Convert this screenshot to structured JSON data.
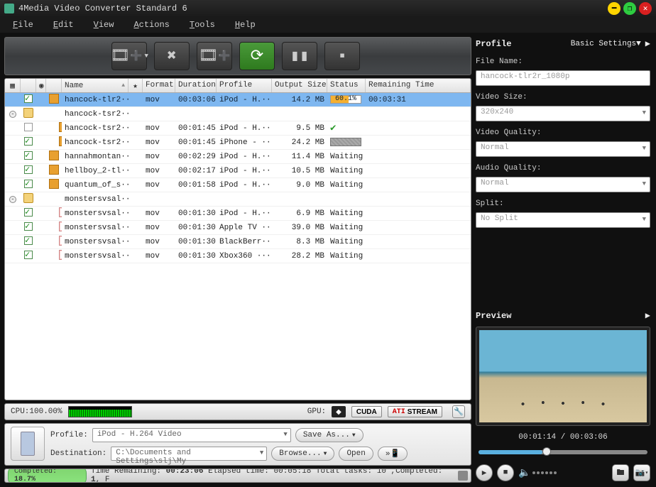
{
  "title": "4Media Video Converter Standard 6",
  "menu": {
    "file": "File",
    "edit": "Edit",
    "view": "View",
    "actions": "Actions",
    "tools": "Tools",
    "help": "Help"
  },
  "columns": {
    "name": "Name",
    "format": "Format",
    "duration": "Duration",
    "profile": "Profile",
    "output": "Output Size",
    "status": "Status",
    "remaining": "Remaining Time"
  },
  "rows": [
    {
      "sel": true,
      "chk": true,
      "kind": "video",
      "indent": 0,
      "name": "hancock-tlr2···",
      "fmt": "mov",
      "dur": "00:03:06",
      "prof": "iPod - H.···",
      "size": "14.2 MB",
      "status_kind": "progress",
      "status_text": "60.1%",
      "status_pct": 60,
      "rem": "00:03:31"
    },
    {
      "chk": null,
      "kind": "folder",
      "indent": 0,
      "exp": "-",
      "name": "hancock-tsr2···"
    },
    {
      "chk": false,
      "kind": "video",
      "indent": 1,
      "name": "hancock-tsr2···",
      "fmt": "mov",
      "dur": "00:01:45",
      "prof": "iPod - H.···",
      "size": "9.5 MB",
      "status_kind": "done"
    },
    {
      "chk": true,
      "kind": "video",
      "indent": 1,
      "name": "hancock-tsr2···",
      "fmt": "mov",
      "dur": "00:01:45",
      "prof": "iPhone - ···",
      "size": "24.2 MB",
      "status_kind": "greyprog"
    },
    {
      "chk": true,
      "kind": "video",
      "indent": 0,
      "name": "hannahmontan···",
      "fmt": "mov",
      "dur": "00:02:29",
      "prof": "iPod - H.···",
      "size": "11.4 MB",
      "status_kind": "text",
      "status_text": "Waiting"
    },
    {
      "chk": true,
      "kind": "video",
      "indent": 0,
      "name": "hellboy_2-tl···",
      "fmt": "mov",
      "dur": "00:02:17",
      "prof": "iPod - H.···",
      "size": "10.5 MB",
      "status_kind": "text",
      "status_text": "Waiting"
    },
    {
      "chk": true,
      "kind": "video",
      "indent": 0,
      "name": "quantum_of_s···",
      "fmt": "mov",
      "dur": "00:01:58",
      "prof": "iPod - H.···",
      "size": "9.0 MB",
      "status_kind": "text",
      "status_text": "Waiting"
    },
    {
      "chk": null,
      "kind": "folder",
      "indent": 0,
      "exp": "-",
      "name": "monstersvsal···"
    },
    {
      "chk": true,
      "kind": "output",
      "indent": 1,
      "name": "monstersvsal···",
      "fmt": "mov",
      "dur": "00:01:30",
      "prof": "iPod - H.···",
      "size": "6.9 MB",
      "status_kind": "text",
      "status_text": "Waiting"
    },
    {
      "chk": true,
      "kind": "output",
      "indent": 1,
      "name": "monstersvsal···",
      "fmt": "mov",
      "dur": "00:01:30",
      "prof": "Apple TV ···",
      "size": "39.0 MB",
      "status_kind": "text",
      "status_text": "Waiting"
    },
    {
      "chk": true,
      "kind": "output",
      "indent": 1,
      "name": "monstersvsal···",
      "fmt": "mov",
      "dur": "00:01:30",
      "prof": "BlackBerr···",
      "size": "8.3 MB",
      "status_kind": "text",
      "status_text": "Waiting"
    },
    {
      "chk": true,
      "kind": "output",
      "indent": 1,
      "name": "monstersvsal···",
      "fmt": "mov",
      "dur": "00:01:30",
      "prof": "Xbox360 ···",
      "size": "28.2 MB",
      "status_kind": "text",
      "status_text": "Waiting"
    }
  ],
  "gpu": {
    "cpu_label": "CPU:",
    "cpu_value": "100.00%",
    "gpu_label": "GPU:",
    "cuda": "CUDA",
    "ati": "ATI STREAM"
  },
  "bottom": {
    "profile_label": "Profile:",
    "profile_value": "iPod - H.264 Video",
    "dest_label": "Destination:",
    "dest_value": "C:\\Documents and Settings\\slj\\My ",
    "saveas": "Save As...",
    "browse": "Browse...",
    "open": "Open"
  },
  "status": {
    "completed_label": "Completed:",
    "completed_pct": "18.7%",
    "time_remaining_label": "Time Remaining:",
    "time_remaining": "00:23:06",
    "elapsed_label": "Elapsed time:",
    "elapsed": "00:05:18",
    "total_label": "Total tasks:",
    "total": "10",
    "comp_label": "Completed:",
    "comp": "1",
    "f_label": "F"
  },
  "profile_panel": {
    "title": "Profile",
    "settings": "Basic Settings▼",
    "filename_label": "File Name:",
    "filename": "hancock-tlr2r_1080p",
    "videosize_label": "Video Size:",
    "videosize": "320x240",
    "vq_label": "Video Quality:",
    "vq": "Normal",
    "aq_label": "Audio Quality:",
    "aq": "Normal",
    "split_label": "Split:",
    "split": "No Split"
  },
  "preview": {
    "title": "Preview",
    "time": "00:01:14 / 00:03:06"
  }
}
